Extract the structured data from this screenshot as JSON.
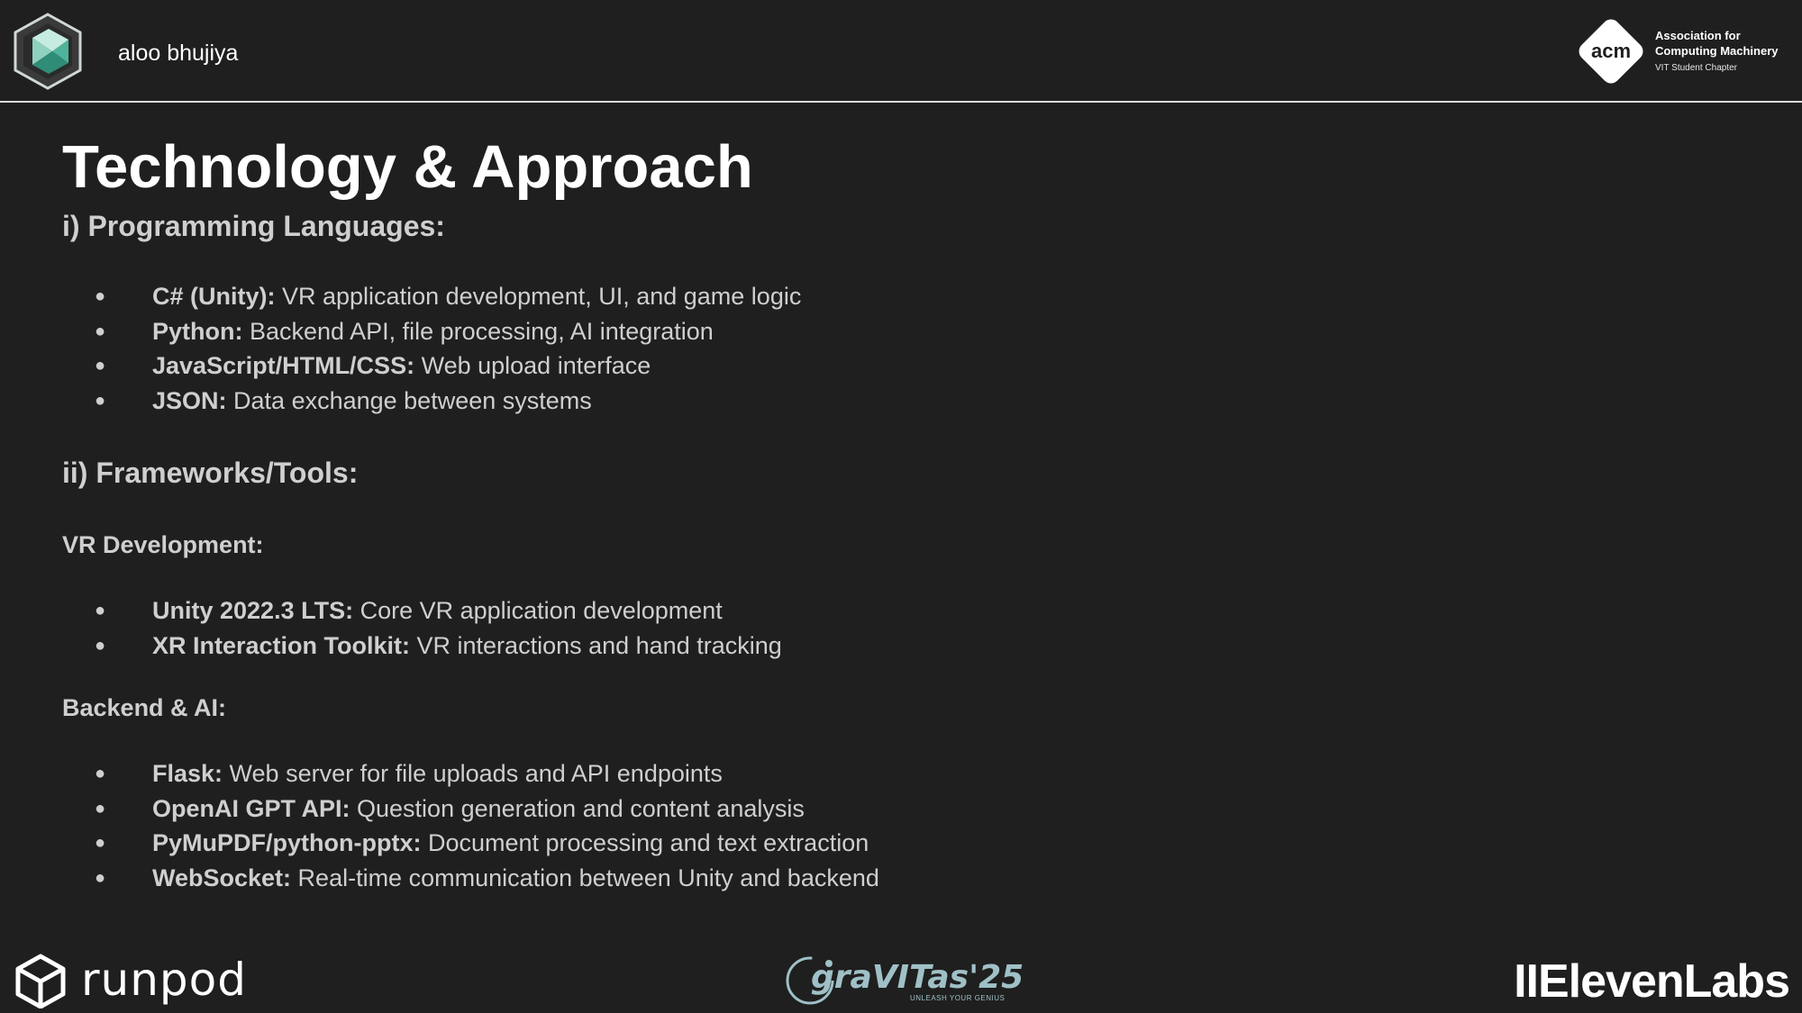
{
  "header": {
    "team_name": "aloo bhujiya",
    "acm": {
      "logo_text": "acm",
      "line1": "Association for",
      "line2": "Computing Machinery",
      "line3": "VIT Student Chapter"
    }
  },
  "slide": {
    "title": "Technology & Approach",
    "section1": "i) Programming Languages:",
    "languages": [
      {
        "label": "C# (Unity):",
        "text": " VR application development, UI, and game logic"
      },
      {
        "label": "Python:",
        "text": " Backend API, file processing, AI integration"
      },
      {
        "label": "JavaScript/HTML/CSS:",
        "text": " Web upload interface"
      },
      {
        "label": "JSON:",
        "text": " Data exchange between systems"
      }
    ],
    "section2": "ii) Frameworks/Tools:",
    "vr_heading": "VR Development:",
    "vr_items": [
      {
        "label": "Unity 2022.3 LTS:",
        "text": " Core VR application development"
      },
      {
        "label": "XR Interaction Toolkit:",
        "text": " VR interactions and hand tracking"
      }
    ],
    "backend_heading": "Backend & AI:",
    "backend_items": [
      {
        "label": "Flask:",
        "text": " Web server for file uploads and API endpoints"
      },
      {
        "label": "OpenAI GPT API:",
        "text": " Question generation and content analysis"
      },
      {
        "label": "PyMuPDF/python-pptx:",
        "text": " Document processing and text extraction"
      },
      {
        "label": "WebSocket:",
        "text": " Real-time communication between Unity and backend"
      }
    ],
    "bullet_glyph": "●"
  },
  "footer": {
    "runpod": "runpod",
    "gravitas": "graVITas'25",
    "gravitas_tag": "UNLEASH YOUR GENIUS",
    "elevenlabs": "IIElevenLabs"
  }
}
